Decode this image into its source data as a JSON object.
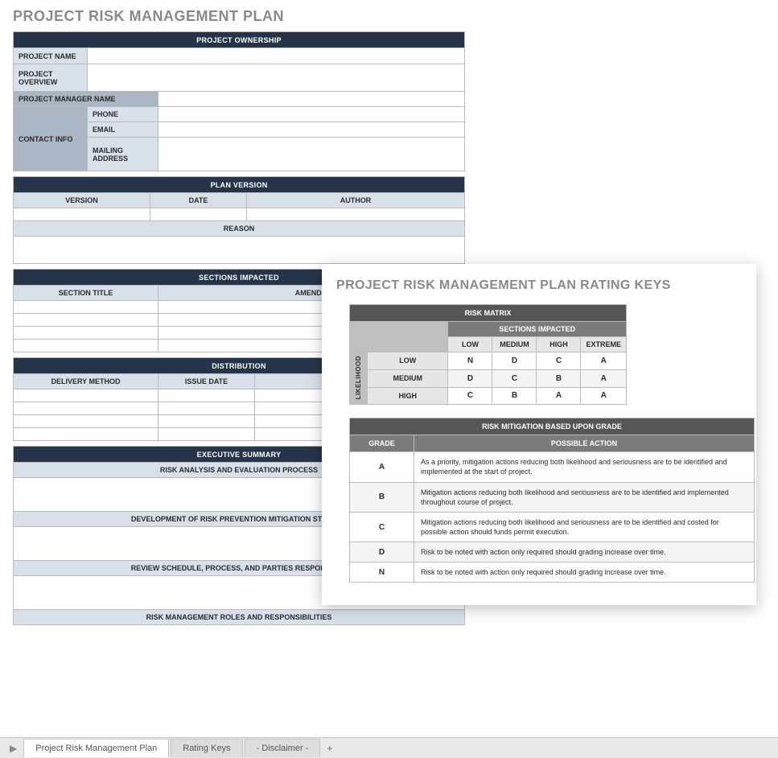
{
  "title": "PROJECT RISK MANAGEMENT PLAN",
  "ownership": {
    "header": "PROJECT OWNERSHIP",
    "project_name_label": "PROJECT NAME",
    "project_overview_label": "PROJECT OVERVIEW",
    "project_manager_label": "PROJECT MANAGER NAME",
    "contact_label": "CONTACT INFO",
    "phone_label": "PHONE",
    "email_label": "EMAIL",
    "mailing_label": "MAILING ADDRESS"
  },
  "plan_version": {
    "header": "PLAN VERSION",
    "version_label": "VERSION",
    "date_label": "DATE",
    "author_label": "AUTHOR",
    "reason_label": "REASON"
  },
  "sections_impacted": {
    "header": "SECTIONS IMPACTED",
    "section_title_label": "SECTION TITLE",
    "amendment_label": "AMENDM"
  },
  "distribution": {
    "header": "DISTRIBUTION",
    "delivery_label": "DELIVERY METHOD",
    "issue_date_label": "ISSUE DATE"
  },
  "exec_summary": {
    "header": "EXECUTIVE SUMMARY",
    "sub1": "RISK ANALYSIS AND EVALUATION PROCESS",
    "sub2": "DEVELOPMENT OF RISK PREVENTION MITIGATION STRATEG",
    "sub3": "REVIEW SCHEDULE, PROCESS, AND PARTIES RESPONSIBLE",
    "sub4": "RISK MANAGEMENT ROLES AND RESPONSIBILITIES"
  },
  "popup": {
    "title": "PROJECT RISK MANAGEMENT PLAN RATING KEYS",
    "matrix": {
      "header": "RISK MATRIX",
      "impact_header": "SECTIONS IMPACTED",
      "likelihood_label": "LIKELIHOOD",
      "cols": [
        "LOW",
        "MEDIUM",
        "HIGH",
        "EXTREME"
      ],
      "rows": [
        "LOW",
        "MEDIUM",
        "HIGH"
      ],
      "grid": [
        [
          "N",
          "D",
          "C",
          "A"
        ],
        [
          "D",
          "C",
          "B",
          "A"
        ],
        [
          "C",
          "B",
          "A",
          "A"
        ]
      ]
    },
    "mitigation": {
      "header": "RISK MITIGATION BASED UPON GRADE",
      "grade_label": "GRADE",
      "action_label": "POSSIBLE ACTION",
      "rows": [
        {
          "grade": "A",
          "action": "As a priority, mitigation actions reducing both likelihood and seriousness are to be identified and implemented at the start of project."
        },
        {
          "grade": "B",
          "action": "Mitigation actions reducing both likelihood and seriousness are to be identified and implemented throughout course of project."
        },
        {
          "grade": "C",
          "action": "Mitigation actions reducing both likelihood and seriousness are to be identified and costed for possible action should funds permit execution."
        },
        {
          "grade": "D",
          "action": "Risk to be noted with action only required should grading increase over time."
        },
        {
          "grade": "N",
          "action": "Risk to be noted with action only required should grading increase over time."
        }
      ]
    }
  },
  "tabs": {
    "nav": "▶",
    "items": [
      "Project Risk Management Plan",
      "Rating Keys",
      "- Disclaimer -"
    ],
    "add": "+"
  }
}
